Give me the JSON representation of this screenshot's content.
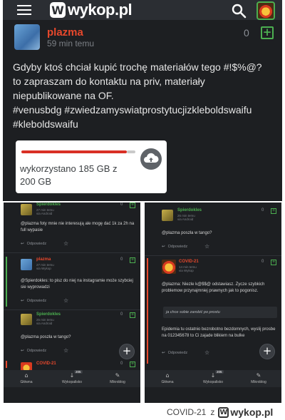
{
  "top": {
    "app": {
      "logo_text": "wykop.pl",
      "logo_letter": "W"
    },
    "post": {
      "author": "plazma",
      "time": "59 min temu",
      "score": "0",
      "plus_label": "+",
      "body_lines": [
        "Gdyby ktoś chciał kupić trochę materiałów tego #!$%@?",
        "to zapraszam do kontaktu na priv, materiały",
        "niepublikowane na OF.",
        "#venusbdg #zwiedzamyswiatprostytucjizkleboldswaifu",
        "#kleboldswaifu"
      ],
      "attachment": {
        "storage_text": "wykorzystano 185 GB z 200 GB",
        "used_gb": 185,
        "total_gb": 200
      }
    }
  },
  "left_panel": {
    "comments": [
      {
        "author": "Spierdokles",
        "time": "27 min temu",
        "via": "via Android",
        "score": "0",
        "text": "@plazma foty mnie nie interesują ale mogę dać 1k za 2h na full wypasie",
        "reply_label": "Odpowiedz"
      },
      {
        "author": "plazma",
        "time": "27 min temu",
        "via": "via Wykop",
        "score": "0",
        "text": "@Spierdokles: to pisz do niej na instagramie może szybciej sie wyprowadzi",
        "reply_label": "Odpowiedz"
      },
      {
        "author": "Spierdokles",
        "time": "25 min temu",
        "via": "via Android",
        "score": "0",
        "text": "@plazma poszła w tango?",
        "reply_label": "Odpowiedz"
      },
      {
        "author": "COVID-21",
        "time": "",
        "via": "",
        "score": "0",
        "text": "",
        "reply_label": ""
      }
    ],
    "tabs": [
      {
        "label": "Główna",
        "icon": "home-icon"
      },
      {
        "label": "Wykopalisko",
        "icon": "shovel-icon",
        "badge": "205"
      },
      {
        "label": "Mikroblog",
        "icon": "mikroblog-icon"
      }
    ],
    "fab": "+"
  },
  "right_panel": {
    "comments": [
      {
        "author": "Spierdokles",
        "time": "26 min temu",
        "via": "via Android",
        "score": "0",
        "text": "@plazma poszła w tango?",
        "reply_label": "Odpowiedz"
      },
      {
        "author": "COVID-21",
        "time": "14 min temu",
        "via": "via Wykop",
        "score": "0",
        "text": "@plazma: Niezle k@$$@ odstawiasz. Zycze szybkich problemow przynajmniej prawnych jak to pogonisz.",
        "quote": "ja chce sobie zarobić po prostu",
        "text2": "Epidemia tu ostatnio bezrobotno bezdomnych, wyslij prosbe na 012345678 to Ci zajade blikiem na bulke",
        "reply_label": "Odpowiedz"
      }
    ],
    "tabs": [
      {
        "label": "Główna",
        "icon": "home-icon"
      },
      {
        "label": "Wykopalisko",
        "icon": "shovel-icon",
        "badge": "205"
      },
      {
        "label": "Mikroblog",
        "icon": "mikroblog-icon"
      }
    ],
    "fab": "+"
  },
  "footer": {
    "prefix": "COVID-21",
    "z": "z",
    "logo_letter": "W",
    "site": "wykop.pl"
  },
  "colors": {
    "accent_green": "#4caf50",
    "author_orange": "#e8482c",
    "bg_dark": "#1d1f22"
  }
}
